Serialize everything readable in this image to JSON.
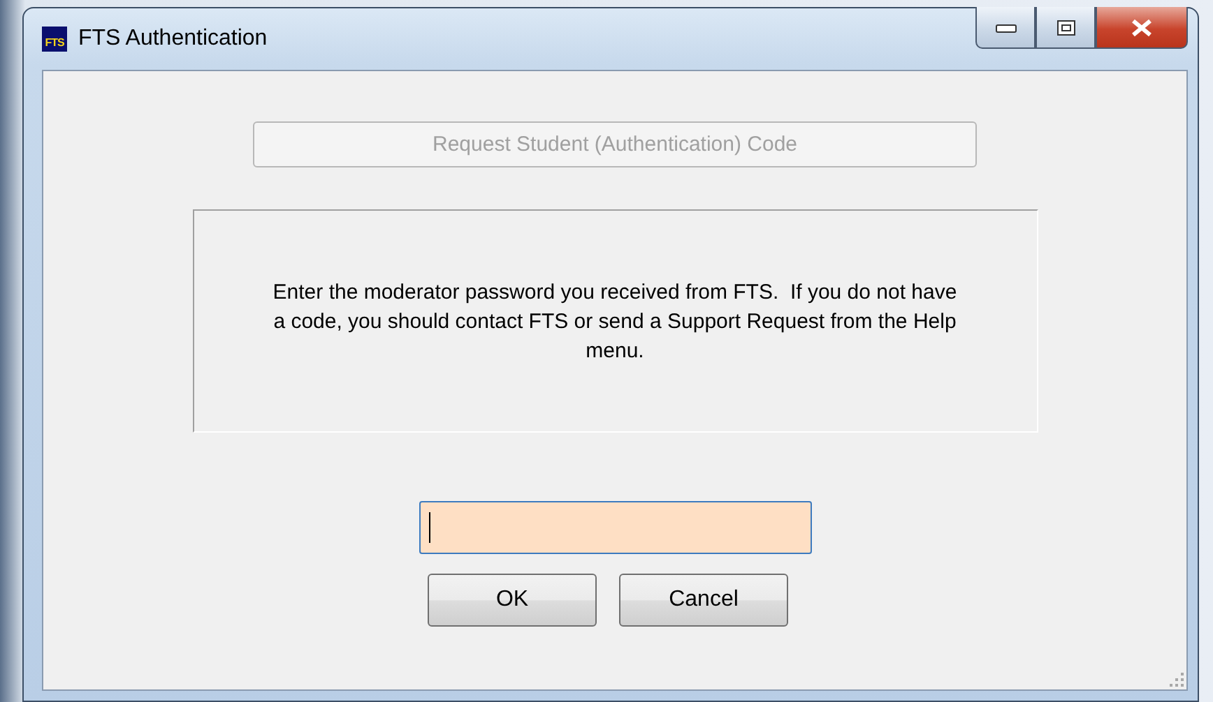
{
  "window": {
    "title": "FTS Authentication",
    "icon_text": "FTS"
  },
  "request_button": {
    "label": "Request Student (Authentication) Code",
    "disabled": true
  },
  "message": "Enter the moderator password you received from FTS.  If you do not have a code, you should contact FTS or send a Support Request from the Help menu.",
  "password_field": {
    "focused": true
  },
  "buttons": [
    {
      "label": "OK"
    },
    {
      "label": "Cancel"
    }
  ]
}
